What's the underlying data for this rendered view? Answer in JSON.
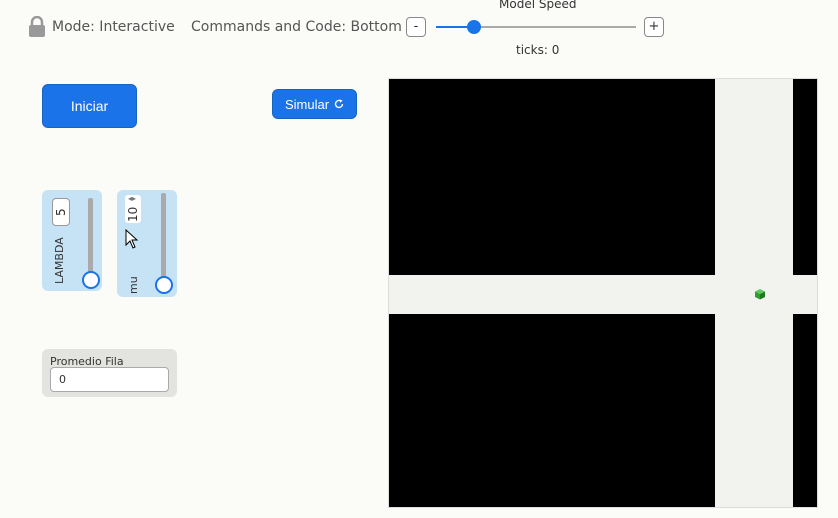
{
  "toolbar": {
    "mode_label": "Mode: Interactive",
    "commands_label": "Commands and Code: Bottom",
    "speed_title": "Model Speed",
    "speed_minus": "-",
    "speed_plus": "+",
    "ticks_label": "ticks: 0"
  },
  "buttons": {
    "start_label": "Iniciar",
    "simulate_label": "Simular"
  },
  "sliders": {
    "lambda": {
      "label": "LAMBDA",
      "value": "5",
      "level": 0.0
    },
    "mu": {
      "label": "mu",
      "value": "10",
      "level": 0.0
    }
  },
  "monitor": {
    "label": "Promedio Fila",
    "value": "0"
  },
  "colors": {
    "accent": "#1a73e8",
    "slider_bg": "#c6e2f5",
    "world_road": "#f2f2ee",
    "world_block": "#000000",
    "turtle": "#2e9e2e"
  },
  "icons": {
    "lock": "lock-icon",
    "refresh": "refresh-icon",
    "cursor": "cursor-icon",
    "turtle": "turtle-cube-icon"
  }
}
